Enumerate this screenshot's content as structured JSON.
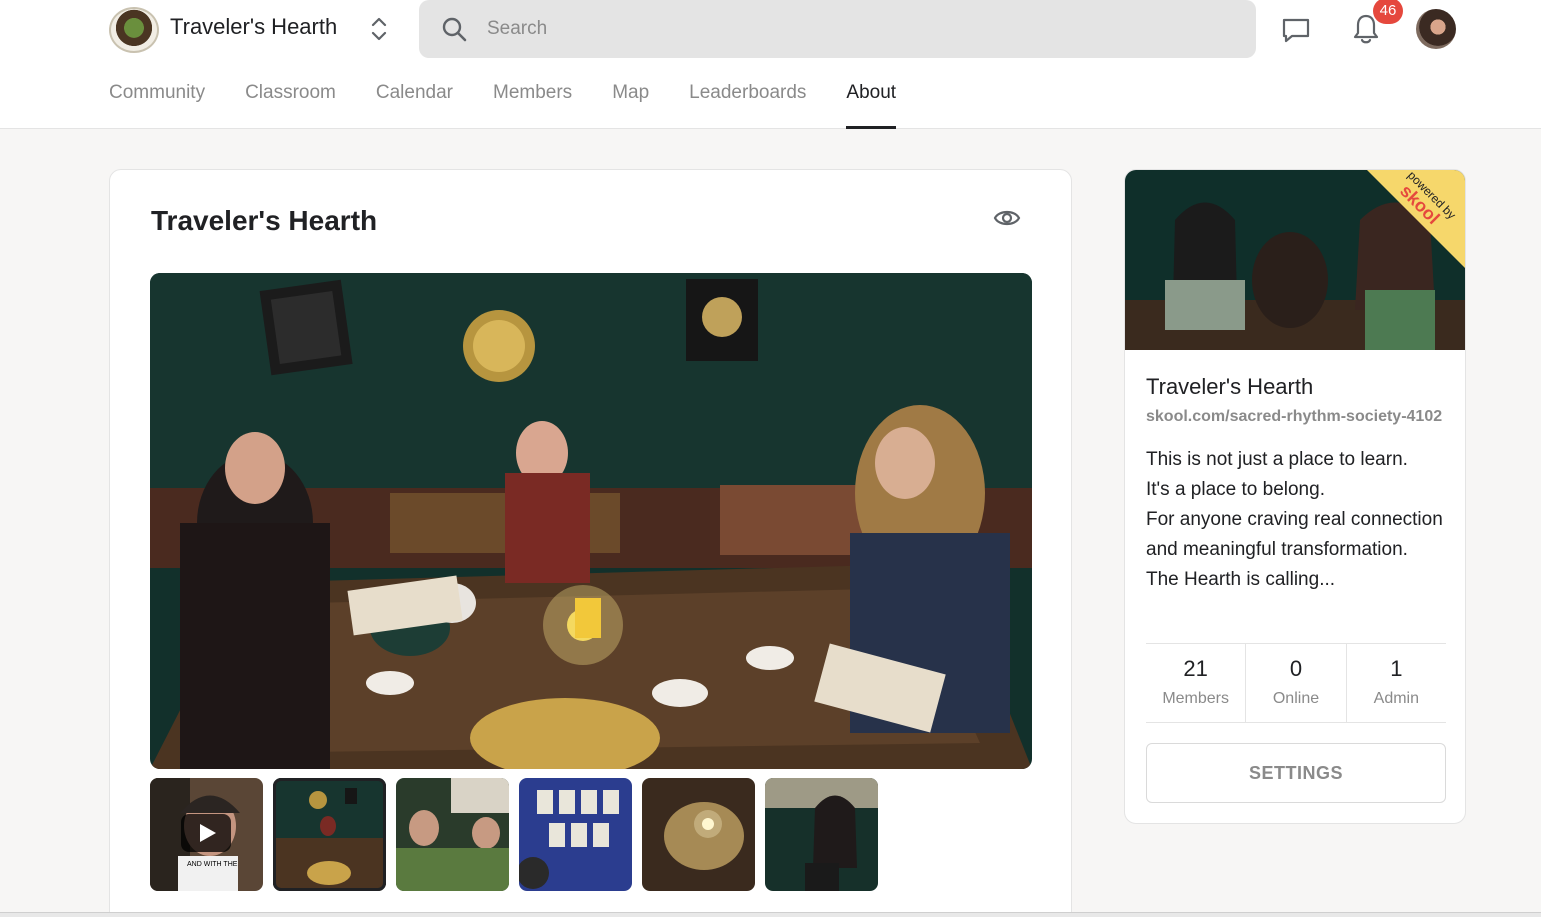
{
  "header": {
    "brand": "Traveler's Hearth",
    "search_placeholder": "Search",
    "notification_count": "46"
  },
  "nav": {
    "tabs": [
      {
        "label": "Community",
        "active": false
      },
      {
        "label": "Classroom",
        "active": false
      },
      {
        "label": "Calendar",
        "active": false
      },
      {
        "label": "Members",
        "active": false
      },
      {
        "label": "Map",
        "active": false
      },
      {
        "label": "Leaderboards",
        "active": false
      },
      {
        "label": "About",
        "active": true
      }
    ]
  },
  "main": {
    "title": "Traveler's Hearth",
    "thumbnail_count": 6,
    "selected_thumbnail": 2,
    "thumbnail_caption": "AND WITH THE"
  },
  "sidebar": {
    "title": "Traveler's Hearth",
    "url": "skool.com/sacred-rhythm-society-4102",
    "description": [
      "This is not just a place to learn.",
      "It's a place to belong.",
      "For anyone craving real connection and meaningful transformation.",
      "The Hearth is calling..."
    ],
    "stats": [
      {
        "value": "21",
        "label": "Members"
      },
      {
        "value": "0",
        "label": "Online"
      },
      {
        "value": "1",
        "label": "Admin"
      }
    ],
    "settings_label": "SETTINGS",
    "ribbon_top": "powered by",
    "ribbon_brand": "skool"
  },
  "colors": {
    "accent": "#202124",
    "muted": "#8a8a8a",
    "badge": "#e5483d",
    "ribbon": "#f6d76b"
  }
}
